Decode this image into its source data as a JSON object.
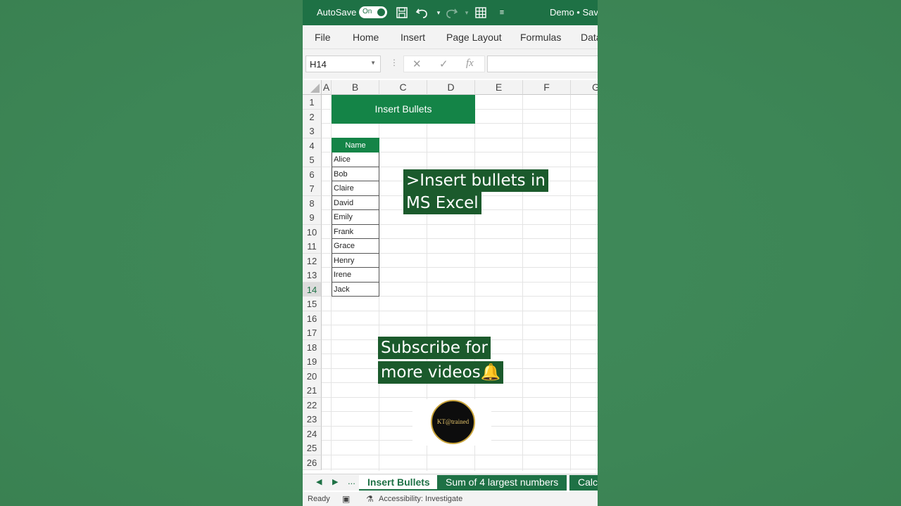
{
  "titlebar": {
    "autosave_label": "AutoSave",
    "autosave_state": "On",
    "doc_title": "Demo • Sav",
    "icons": [
      "save-icon",
      "undo-icon",
      "redo-icon",
      "table-icon",
      "customize-icon"
    ]
  },
  "ribbon": {
    "tabs": [
      "File",
      "Home",
      "Insert",
      "Page Layout",
      "Formulas",
      "Data"
    ]
  },
  "formula_bar": {
    "name_box": "H14",
    "formula": ""
  },
  "grid": {
    "columns": [
      "A",
      "B",
      "C",
      "D",
      "E",
      "F",
      "G"
    ],
    "rows": [
      "1",
      "2",
      "3",
      "4",
      "5",
      "6",
      "7",
      "8",
      "9",
      "10",
      "11",
      "12",
      "13",
      "14",
      "15",
      "16",
      "17",
      "18",
      "19",
      "20",
      "21",
      "22",
      "23",
      "24",
      "25",
      "26"
    ],
    "selected_row": "14"
  },
  "content": {
    "title": "Insert Bullets",
    "table_header": "Name",
    "names": [
      "Alice",
      "Bob",
      "Claire",
      "David",
      "Emily",
      "Frank",
      "Grace",
      "Henry",
      "Irene",
      "Jack"
    ],
    "callout1_line1": ">Insert bullets in",
    "callout1_line2": "MS Excel",
    "callout2_line1": "Subscribe for",
    "callout2_line2": "more videos🔔",
    "logo_text": "KT@trained"
  },
  "sheets": {
    "overflow": "...",
    "tabs": [
      "Insert Bullets",
      "Sum of 4 largest numbers",
      "Calcu"
    ]
  },
  "status": {
    "ready": "Ready",
    "accessibility": "Accessibility: Investigate"
  },
  "colors": {
    "excel_green": "#1e7145",
    "accent_green": "#148447",
    "callout_bg": "#1b5a2c",
    "background": "#3d8656"
  }
}
